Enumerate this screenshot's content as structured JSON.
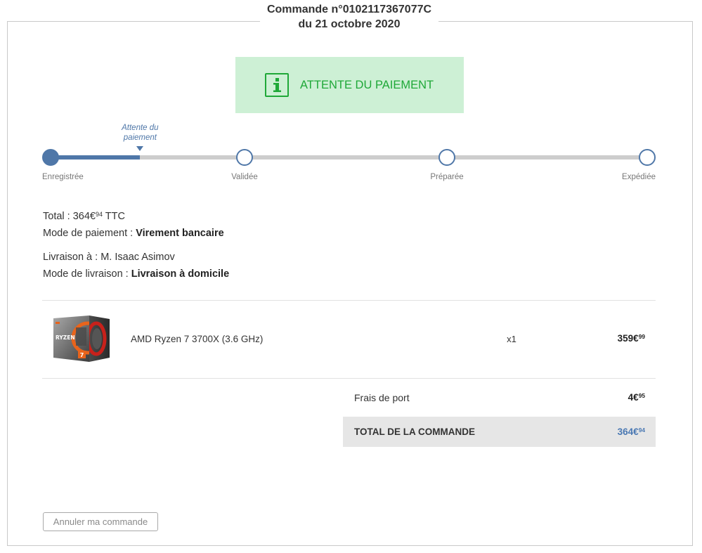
{
  "header": {
    "order_title": "Commande n°0102117367077C",
    "order_date": "du 21 octobre 2020"
  },
  "status_banner": {
    "icon": "info-icon",
    "label": "ATTENTE DU PAIEMENT",
    "background_color": "#cdf0d5",
    "color": "#1fa838"
  },
  "progress": {
    "accent_color": "#4f77a8",
    "fill_fraction": 0.15,
    "current_label_line1": "Attente du",
    "current_label_line2": "paiement",
    "steps": [
      {
        "label": "Enregistrée",
        "completed": true
      },
      {
        "label": "Validée",
        "completed": false
      },
      {
        "label": "Préparée",
        "completed": false
      },
      {
        "label": "Expédiée",
        "completed": false
      }
    ]
  },
  "summary": {
    "total": {
      "label": "Total :",
      "euros": "364€",
      "cents": "94",
      "suffix": "TTC"
    },
    "payment": {
      "label": "Mode de paiement :",
      "value": "Virement bancaire"
    },
    "delivery_to": {
      "label": "Livraison à :",
      "value": "M. Isaac Asimov"
    },
    "delivery_mode": {
      "label": "Mode de livraison :",
      "value": "Livraison à domicile"
    }
  },
  "items": [
    {
      "image_brand_text": "RYZEN",
      "image_badge_text": "7",
      "name": "AMD Ryzen 7 3700X (3.6 GHz)",
      "quantity": "x1",
      "price_euros": "359€",
      "price_cents": "99"
    }
  ],
  "shipping": {
    "label": "Frais de port",
    "euros": "4€",
    "cents": "95"
  },
  "order_total": {
    "label": "TOTAL DE LA COMMANDE",
    "euros": "364€",
    "cents": "94",
    "color": "#4a78b3",
    "background_color": "#e6e6e6"
  },
  "actions": {
    "cancel_label": "Annuler ma commande"
  }
}
